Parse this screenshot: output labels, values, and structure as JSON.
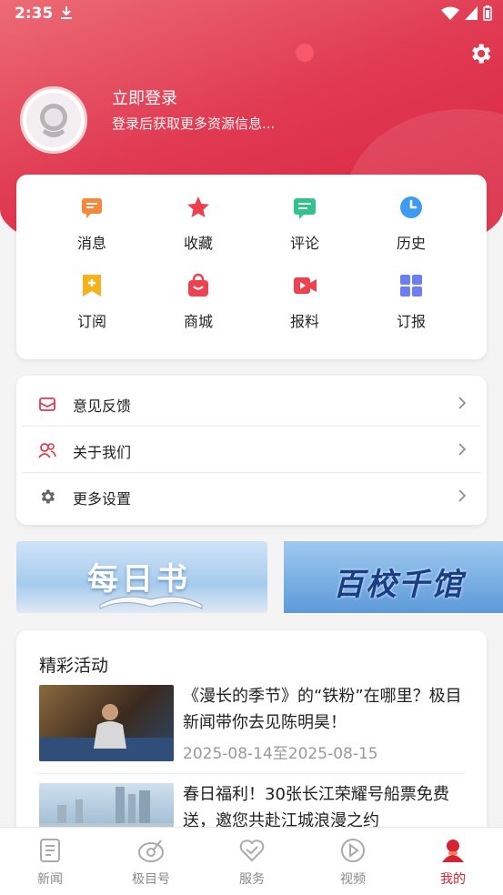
{
  "status_bar": {
    "time": "2:35"
  },
  "profile": {
    "login_title": "立即登录",
    "login_subtitle": "登录后获取更多资源信息..."
  },
  "quick_grid": [
    {
      "label": "消息",
      "icon": "message-icon",
      "color": "#f6883a"
    },
    {
      "label": "收藏",
      "icon": "star-icon",
      "color": "#ef3e4e"
    },
    {
      "label": "评论",
      "icon": "comment-icon",
      "color": "#2fc48a"
    },
    {
      "label": "历史",
      "icon": "clock-icon",
      "color": "#3d9bf0"
    },
    {
      "label": "订阅",
      "icon": "subscribe-icon",
      "color": "#f7b21b"
    },
    {
      "label": "商城",
      "icon": "shopping-bag-icon",
      "color": "#ef4251"
    },
    {
      "label": "报料",
      "icon": "video-camera-icon",
      "color": "#ef4251"
    },
    {
      "label": "订报",
      "icon": "grid-icon",
      "color": "#6c7ff2"
    }
  ],
  "menu": [
    {
      "label": "意见反馈",
      "icon": "feedback-mail-icon"
    },
    {
      "label": "关于我们",
      "icon": "people-icon"
    },
    {
      "label": "更多设置",
      "icon": "gear-icon"
    }
  ],
  "banners": [
    {
      "title": "每日书"
    },
    {
      "title": "百校千馆"
    }
  ],
  "activities": {
    "section_title": "精彩活动",
    "items": [
      {
        "title": "《漫长的季节》的“铁粉”在哪里？极目新闻带你去见陈明昊！",
        "date": "2025-08-14至2025-08-15"
      },
      {
        "title": "春日福利！30张长江荣耀号船票免费送，邀您共赴江城浪漫之约",
        "date": ""
      }
    ]
  },
  "tabbar": [
    {
      "label": "新闻",
      "icon": "news-icon",
      "active": false
    },
    {
      "label": "极目号",
      "icon": "jimu-icon",
      "active": false
    },
    {
      "label": "服务",
      "icon": "service-icon",
      "active": false
    },
    {
      "label": "视频",
      "icon": "play-icon",
      "active": false
    },
    {
      "label": "我的",
      "icon": "user-icon",
      "active": true
    }
  ],
  "colors": {
    "accent": "#d62332",
    "hero_start": "#ec6b75",
    "hero_end": "#d8203c"
  }
}
